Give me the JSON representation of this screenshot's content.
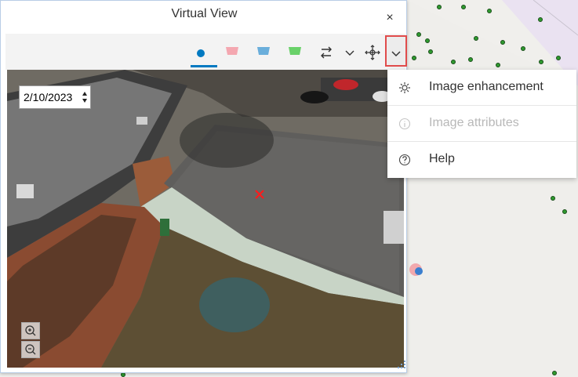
{
  "window": {
    "title": "Virtual View",
    "close_symbol": "×"
  },
  "toolbar": {
    "buttons": [
      {
        "name": "view-dot",
        "active": true,
        "color": "#0079c1"
      },
      {
        "name": "view-pink",
        "color": "#f4a7b0"
      },
      {
        "name": "view-blue",
        "color": "#6aaedb"
      },
      {
        "name": "view-green",
        "color": "#69d169"
      }
    ]
  },
  "viewer": {
    "date": "2/10/2023"
  },
  "menu": {
    "items": [
      {
        "label": "Image enhancement",
        "icon": "settings-icon",
        "enabled": true
      },
      {
        "label": "Image attributes",
        "icon": "info-icon",
        "enabled": false
      },
      {
        "label": "Help",
        "icon": "help-icon",
        "enabled": true
      }
    ]
  },
  "colors": {
    "accent": "#0079c1",
    "highlight_border": "#e04b4b",
    "map_point": "#2f9a2f"
  }
}
